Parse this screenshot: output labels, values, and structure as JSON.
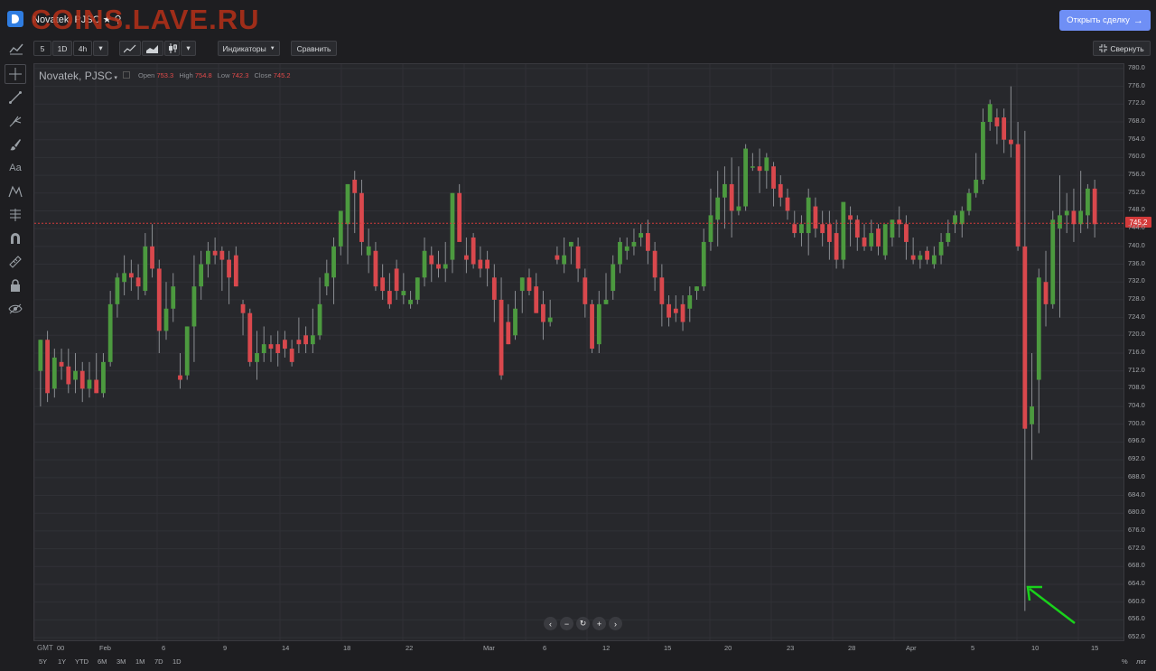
{
  "watermark": "COINS.LAVE.RU",
  "header": {
    "instrument_title": "Novatek, PJSC ★ ⚲",
    "open_trade_label": "Открыть сделку"
  },
  "toolbar": {
    "interval_5": "5",
    "interval_1d": "1D",
    "interval_4h": "4h",
    "indicators_label": "Индикаторы",
    "compare_label": "Сравнить",
    "collapse_label": "Свернуть"
  },
  "left_tools": [
    "crosshair-icon",
    "trend-line-icon",
    "fork-icon",
    "brush-icon",
    "text-icon",
    "pattern-icon",
    "fibonacci-icon",
    "magnet-icon",
    "ruler-icon",
    "lock-icon",
    "eye-hide-icon"
  ],
  "legend": {
    "name": "Novatek, PJSC",
    "open_label": "Open",
    "open": "753.3",
    "high_label": "High",
    "high": "754.8",
    "low_label": "Low",
    "low": "742.3",
    "close_label": "Close",
    "close": "745.2"
  },
  "last_price_label": "745.2",
  "time_labels": [
    "GMT",
    "00",
    "Feb",
    "6",
    "9",
    "14",
    "18",
    "22",
    "Mar",
    "6",
    "12",
    "15",
    "20",
    "23",
    "28",
    "Apr",
    "5",
    "10",
    "15"
  ],
  "ranges": [
    "5Y",
    "1Y",
    "YTD",
    "6M",
    "3M",
    "1M",
    "7D",
    "1D"
  ],
  "scale_toggles": {
    "percent": "%",
    "log": "лог"
  },
  "colors": {
    "up": "#4c9a3f",
    "down": "#d9484d",
    "background": "#27282c",
    "accent_button": "#6f8ff5",
    "last_price": "#d33a3a",
    "annotation_arrow": "#19d21b"
  },
  "chart_data": {
    "type": "candlestick",
    "instrument": "Novatek, PJSC",
    "y_axis_ticks": [
      780,
      776,
      772,
      768,
      764,
      760,
      756,
      752,
      748,
      744,
      740,
      736,
      732,
      728,
      724,
      720,
      716,
      712,
      708,
      704,
      700,
      696,
      692,
      688,
      684,
      680,
      676,
      672,
      668,
      664,
      660,
      656,
      652
    ],
    "y_range": [
      651,
      781
    ],
    "last_price": 745.2,
    "candles": [
      {
        "o": 712,
        "h": 719,
        "l": 704,
        "c": 719
      },
      {
        "o": 719,
        "h": 721,
        "l": 705,
        "c": 707
      },
      {
        "o": 708,
        "h": 717,
        "l": 706,
        "c": 715
      },
      {
        "o": 714,
        "h": 717,
        "l": 710,
        "c": 713
      },
      {
        "o": 713,
        "h": 717,
        "l": 707,
        "c": 709
      },
      {
        "o": 710,
        "h": 716,
        "l": 707,
        "c": 712
      },
      {
        "o": 712,
        "h": 714,
        "l": 705,
        "c": 708
      },
      {
        "o": 708,
        "h": 714,
        "l": 706,
        "c": 710
      },
      {
        "o": 710,
        "h": 716,
        "l": 707,
        "c": 707
      },
      {
        "o": 707,
        "h": 716,
        "l": 706,
        "c": 714
      },
      {
        "o": 714,
        "h": 730,
        "l": 713,
        "c": 727
      },
      {
        "o": 727,
        "h": 734,
        "l": 724,
        "c": 733
      },
      {
        "o": 732,
        "h": 738,
        "l": 729,
        "c": 734
      },
      {
        "o": 734,
        "h": 737,
        "l": 730,
        "c": 733
      },
      {
        "o": 733,
        "h": 736,
        "l": 728,
        "c": 731
      },
      {
        "o": 730,
        "h": 743,
        "l": 729,
        "c": 740
      },
      {
        "o": 740,
        "h": 745,
        "l": 733,
        "c": 735
      },
      {
        "o": 735,
        "h": 737,
        "l": 716,
        "c": 721
      },
      {
        "o": 721,
        "h": 732,
        "l": 719,
        "c": 726
      },
      {
        "o": 726,
        "h": 734,
        "l": 723,
        "c": 731
      },
      {
        "o": 711,
        "h": 716,
        "l": 708,
        "c": 710
      },
      {
        "o": 711,
        "h": 722,
        "l": 710,
        "c": 722
      },
      {
        "o": 722,
        "h": 738,
        "l": 714,
        "c": 731
      },
      {
        "o": 731,
        "h": 739,
        "l": 728,
        "c": 736
      },
      {
        "o": 736,
        "h": 741,
        "l": 733,
        "c": 739
      },
      {
        "o": 739,
        "h": 742,
        "l": 736,
        "c": 738
      },
      {
        "o": 739,
        "h": 740,
        "l": 730,
        "c": 737
      },
      {
        "o": 737,
        "h": 739,
        "l": 727,
        "c": 733
      },
      {
        "o": 738,
        "h": 740,
        "l": 731,
        "c": 731
      },
      {
        "o": 727,
        "h": 728,
        "l": 720,
        "c": 725
      },
      {
        "o": 725,
        "h": 726,
        "l": 713,
        "c": 714
      },
      {
        "o": 714,
        "h": 721,
        "l": 710,
        "c": 716
      },
      {
        "o": 716,
        "h": 722,
        "l": 714,
        "c": 718
      },
      {
        "o": 718,
        "h": 720,
        "l": 714,
        "c": 717
      },
      {
        "o": 718,
        "h": 721,
        "l": 713,
        "c": 716
      },
      {
        "o": 719,
        "h": 721,
        "l": 715,
        "c": 717
      },
      {
        "o": 717,
        "h": 719,
        "l": 713,
        "c": 714
      },
      {
        "o": 719,
        "h": 724,
        "l": 716,
        "c": 718
      },
      {
        "o": 720,
        "h": 722,
        "l": 716,
        "c": 718
      },
      {
        "o": 718,
        "h": 726,
        "l": 716,
        "c": 720
      },
      {
        "o": 720,
        "h": 733,
        "l": 719,
        "c": 727
      },
      {
        "o": 731,
        "h": 737,
        "l": 729,
        "c": 734
      },
      {
        "o": 733,
        "h": 742,
        "l": 727,
        "c": 740
      },
      {
        "o": 740,
        "h": 745,
        "l": 738,
        "c": 748
      },
      {
        "o": 745,
        "h": 754,
        "l": 736,
        "c": 754
      },
      {
        "o": 755,
        "h": 757,
        "l": 743,
        "c": 752
      },
      {
        "o": 752,
        "h": 755,
        "l": 738,
        "c": 741
      },
      {
        "o": 738,
        "h": 744,
        "l": 734,
        "c": 740
      },
      {
        "o": 739,
        "h": 741,
        "l": 730,
        "c": 731
      },
      {
        "o": 733,
        "h": 736,
        "l": 728,
        "c": 730
      },
      {
        "o": 730,
        "h": 734,
        "l": 726,
        "c": 727
      },
      {
        "o": 735,
        "h": 737,
        "l": 728,
        "c": 730
      },
      {
        "o": 729,
        "h": 734,
        "l": 727,
        "c": 730
      },
      {
        "o": 727,
        "h": 730,
        "l": 726,
        "c": 728
      },
      {
        "o": 728,
        "h": 733,
        "l": 727,
        "c": 733
      },
      {
        "o": 733,
        "h": 742,
        "l": 731,
        "c": 739
      },
      {
        "o": 738,
        "h": 740,
        "l": 732,
        "c": 736
      },
      {
        "o": 736,
        "h": 739,
        "l": 733,
        "c": 735
      },
      {
        "o": 735,
        "h": 741,
        "l": 732,
        "c": 736
      },
      {
        "o": 737,
        "h": 752,
        "l": 734,
        "c": 752
      },
      {
        "o": 752,
        "h": 754,
        "l": 742,
        "c": 741
      },
      {
        "o": 738,
        "h": 742,
        "l": 734,
        "c": 737
      },
      {
        "o": 742,
        "h": 743,
        "l": 735,
        "c": 736
      },
      {
        "o": 737,
        "h": 740,
        "l": 733,
        "c": 735
      },
      {
        "o": 737,
        "h": 739,
        "l": 731,
        "c": 735
      },
      {
        "o": 733,
        "h": 736,
        "l": 723,
        "c": 728
      },
      {
        "o": 728,
        "h": 733,
        "l": 710,
        "c": 711
      },
      {
        "o": 723,
        "h": 727,
        "l": 718,
        "c": 718
      },
      {
        "o": 720,
        "h": 730,
        "l": 719,
        "c": 726
      },
      {
        "o": 730,
        "h": 733,
        "l": 725,
        "c": 733
      },
      {
        "o": 733,
        "h": 735,
        "l": 729,
        "c": 730
      },
      {
        "o": 731,
        "h": 734,
        "l": 725,
        "c": 725
      },
      {
        "o": 727,
        "h": 730,
        "l": 719,
        "c": 723
      },
      {
        "o": 723,
        "h": 728,
        "l": 722,
        "c": 724
      },
      {
        "o": 738,
        "h": 740,
        "l": 736,
        "c": 737
      },
      {
        "o": 736,
        "h": 742,
        "l": 734,
        "c": 738
      },
      {
        "o": 740,
        "h": 741,
        "l": 736,
        "c": 741
      },
      {
        "o": 740,
        "h": 742,
        "l": 732,
        "c": 735
      },
      {
        "o": 733,
        "h": 735,
        "l": 724,
        "c": 727
      },
      {
        "o": 727,
        "h": 728,
        "l": 716,
        "c": 717
      },
      {
        "o": 718,
        "h": 730,
        "l": 716,
        "c": 727
      },
      {
        "o": 727,
        "h": 734,
        "l": 727,
        "c": 728
      },
      {
        "o": 730,
        "h": 738,
        "l": 728,
        "c": 736
      },
      {
        "o": 736,
        "h": 742,
        "l": 734,
        "c": 741
      },
      {
        "o": 739,
        "h": 742,
        "l": 737,
        "c": 740
      },
      {
        "o": 740,
        "h": 744,
        "l": 738,
        "c": 741
      },
      {
        "o": 742,
        "h": 745,
        "l": 740,
        "c": 743
      },
      {
        "o": 743,
        "h": 746,
        "l": 736,
        "c": 739
      },
      {
        "o": 739,
        "h": 741,
        "l": 730,
        "c": 733
      },
      {
        "o": 733,
        "h": 736,
        "l": 722,
        "c": 727
      },
      {
        "o": 727,
        "h": 729,
        "l": 722,
        "c": 724
      },
      {
        "o": 726,
        "h": 729,
        "l": 723,
        "c": 725
      },
      {
        "o": 727,
        "h": 729,
        "l": 721,
        "c": 723
      },
      {
        "o": 726,
        "h": 731,
        "l": 723,
        "c": 729
      },
      {
        "o": 730,
        "h": 731,
        "l": 728,
        "c": 731
      },
      {
        "o": 731,
        "h": 744,
        "l": 730,
        "c": 741
      },
      {
        "o": 741,
        "h": 753,
        "l": 739,
        "c": 747
      },
      {
        "o": 746,
        "h": 757,
        "l": 740,
        "c": 751
      },
      {
        "o": 751,
        "h": 758,
        "l": 744,
        "c": 754
      },
      {
        "o": 754,
        "h": 760,
        "l": 742,
        "c": 748
      },
      {
        "o": 748,
        "h": 758,
        "l": 747,
        "c": 749
      },
      {
        "o": 749,
        "h": 763,
        "l": 748,
        "c": 762
      },
      {
        "o": 758,
        "h": 761,
        "l": 757,
        "c": 758
      },
      {
        "o": 758,
        "h": 762,
        "l": 752,
        "c": 757
      },
      {
        "o": 757,
        "h": 761,
        "l": 753,
        "c": 760
      },
      {
        "o": 758,
        "h": 759,
        "l": 749,
        "c": 753
      },
      {
        "o": 754,
        "h": 756,
        "l": 749,
        "c": 751
      },
      {
        "o": 751,
        "h": 753,
        "l": 746,
        "c": 748
      },
      {
        "o": 745,
        "h": 748,
        "l": 742,
        "c": 743
      },
      {
        "o": 743,
        "h": 747,
        "l": 740,
        "c": 745
      },
      {
        "o": 743,
        "h": 753,
        "l": 738,
        "c": 751
      },
      {
        "o": 749,
        "h": 751,
        "l": 742,
        "c": 744
      },
      {
        "o": 745,
        "h": 748,
        "l": 740,
        "c": 743
      },
      {
        "o": 745,
        "h": 748,
        "l": 737,
        "c": 741
      },
      {
        "o": 743,
        "h": 746,
        "l": 735,
        "c": 737
      },
      {
        "o": 737,
        "h": 747,
        "l": 735,
        "c": 750
      },
      {
        "o": 747,
        "h": 749,
        "l": 740,
        "c": 746
      },
      {
        "o": 746,
        "h": 747,
        "l": 739,
        "c": 742
      },
      {
        "o": 742,
        "h": 745,
        "l": 739,
        "c": 740
      },
      {
        "o": 740,
        "h": 746,
        "l": 739,
        "c": 743
      },
      {
        "o": 744,
        "h": 745,
        "l": 738,
        "c": 740
      },
      {
        "o": 738,
        "h": 744,
        "l": 737,
        "c": 745
      },
      {
        "o": 742,
        "h": 746,
        "l": 740,
        "c": 746
      },
      {
        "o": 746,
        "h": 749,
        "l": 742,
        "c": 745
      },
      {
        "o": 745,
        "h": 747,
        "l": 737,
        "c": 741
      },
      {
        "o": 738,
        "h": 742,
        "l": 736,
        "c": 737
      },
      {
        "o": 737,
        "h": 739,
        "l": 735,
        "c": 738
      },
      {
        "o": 739,
        "h": 740,
        "l": 736,
        "c": 737
      },
      {
        "o": 736,
        "h": 740,
        "l": 735,
        "c": 738
      },
      {
        "o": 738,
        "h": 743,
        "l": 736,
        "c": 741
      },
      {
        "o": 741,
        "h": 746,
        "l": 740,
        "c": 743
      },
      {
        "o": 745,
        "h": 748,
        "l": 743,
        "c": 747
      },
      {
        "o": 745,
        "h": 749,
        "l": 742,
        "c": 748
      },
      {
        "o": 748,
        "h": 753,
        "l": 747,
        "c": 752
      },
      {
        "o": 752,
        "h": 761,
        "l": 751,
        "c": 755
      },
      {
        "o": 755,
        "h": 771,
        "l": 754,
        "c": 768
      },
      {
        "o": 768,
        "h": 773,
        "l": 766,
        "c": 772
      },
      {
        "o": 769,
        "h": 771,
        "l": 763,
        "c": 767
      },
      {
        "o": 769,
        "h": 771,
        "l": 761,
        "c": 764
      },
      {
        "o": 764,
        "h": 776,
        "l": 760,
        "c": 763
      },
      {
        "o": 763,
        "h": 768,
        "l": 739,
        "c": 740
      },
      {
        "o": 740,
        "h": 766,
        "l": 658,
        "c": 699
      },
      {
        "o": 700,
        "h": 716,
        "l": 692,
        "c": 704
      },
      {
        "o": 710,
        "h": 735,
        "l": 698,
        "c": 733
      },
      {
        "o": 732,
        "h": 739,
        "l": 722,
        "c": 727
      },
      {
        "o": 727,
        "h": 748,
        "l": 726,
        "c": 746
      },
      {
        "o": 744,
        "h": 756,
        "l": 724,
        "c": 747
      },
      {
        "o": 747,
        "h": 752,
        "l": 743,
        "c": 748
      },
      {
        "o": 748,
        "h": 753,
        "l": 741,
        "c": 745
      },
      {
        "o": 745,
        "h": 757,
        "l": 743,
        "c": 748
      },
      {
        "o": 747,
        "h": 754,
        "l": 744,
        "c": 753
      },
      {
        "o": 753,
        "h": 755,
        "l": 742,
        "c": 745
      }
    ]
  }
}
